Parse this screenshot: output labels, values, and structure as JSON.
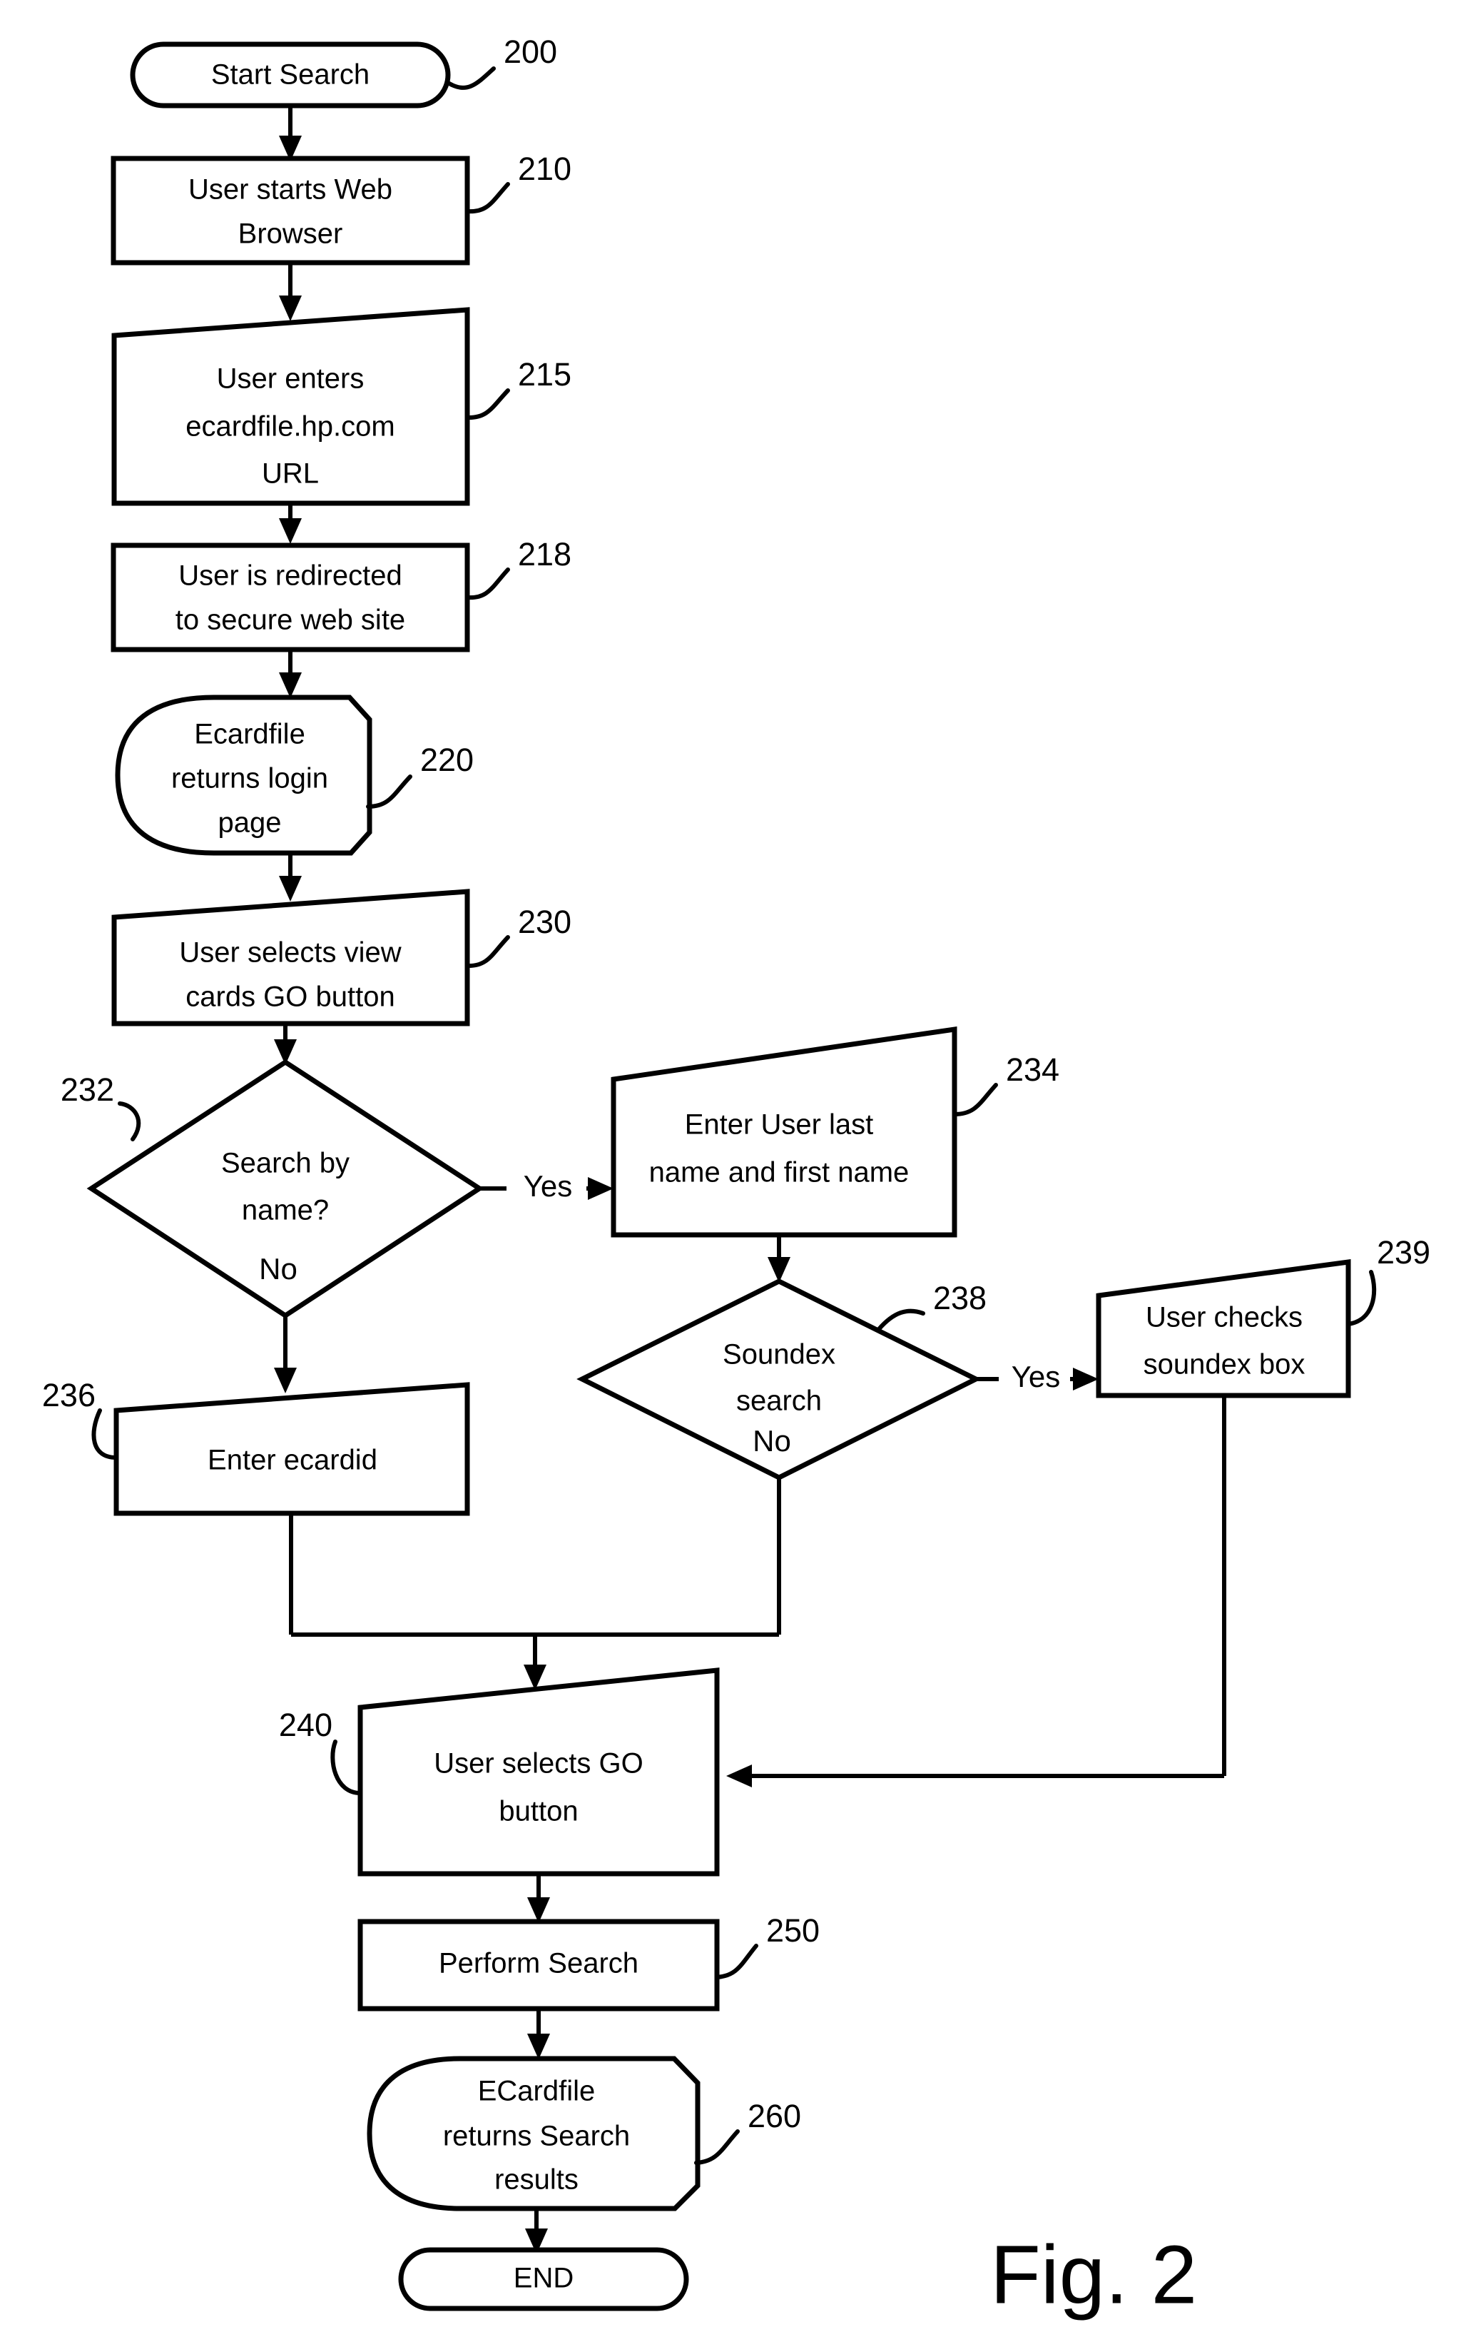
{
  "figure": {
    "caption": "Fig. 2",
    "type": "flowchart"
  },
  "nodes": [
    {
      "ref": "200",
      "shape": "terminator",
      "lines": [
        "Start Search"
      ],
      "text": "Start Search"
    },
    {
      "ref": "210",
      "shape": "rectangle",
      "lines": [
        "User starts Web",
        "Browser"
      ],
      "text": "User starts Web Browser"
    },
    {
      "ref": "215",
      "shape": "slanted-top-quad",
      "lines": [
        "User enters",
        "ecardfile.hp.com",
        "URL"
      ],
      "text": "User enters ecardfile.hp.com URL"
    },
    {
      "ref": "218",
      "shape": "rectangle",
      "lines": [
        "User is redirected",
        "to secure web site"
      ],
      "text": "User is redirected to secure web site"
    },
    {
      "ref": "220",
      "shape": "rounded-blob",
      "lines": [
        "Ecardfile",
        "returns login",
        "page"
      ],
      "text": "Ecardfile returns login page"
    },
    {
      "ref": "230",
      "shape": "slanted-top-quad",
      "lines": [
        "User selects view",
        "cards GO button"
      ],
      "text": "User selects view cards GO button"
    },
    {
      "ref": "232",
      "shape": "diamond",
      "lines": [
        "Search by",
        "name?"
      ],
      "text": "Search by name?"
    },
    {
      "ref": "234",
      "shape": "slanted-top-quad",
      "lines": [
        "Enter User last",
        "name and first name"
      ],
      "text": "Enter User last name and first name"
    },
    {
      "ref": "236",
      "shape": "slanted-top-quad",
      "lines": [
        "Enter ecardid"
      ],
      "text": "Enter ecardid"
    },
    {
      "ref": "238",
      "shape": "diamond",
      "lines": [
        "Soundex",
        "search"
      ],
      "text": "Soundex search"
    },
    {
      "ref": "239",
      "shape": "slanted-top-quad",
      "lines": [
        "User checks",
        "soundex box"
      ],
      "text": "User checks soundex box"
    },
    {
      "ref": "240",
      "shape": "slanted-top-quad",
      "lines": [
        "User selects GO",
        "button"
      ],
      "text": "User selects GO button"
    },
    {
      "ref": "250",
      "shape": "rectangle",
      "lines": [
        "Perform Search"
      ],
      "text": "Perform Search"
    },
    {
      "ref": "260",
      "shape": "rounded-blob",
      "lines": [
        "ECardfile",
        "returns Search",
        "results"
      ],
      "text": "ECardfile returns Search results"
    },
    {
      "ref": "end",
      "shape": "terminator",
      "lines": [
        "END"
      ],
      "text": "END"
    }
  ],
  "edge_labels": {
    "search_by_name_yes": "Yes",
    "search_by_name_no": "No",
    "soundex_yes": "Yes",
    "soundex_no": "No"
  },
  "ref_numbers": {
    "n200": "200",
    "n210": "210",
    "n215": "215",
    "n218": "218",
    "n220": "220",
    "n230": "230",
    "n232": "232",
    "n234": "234",
    "n236": "236",
    "n238": "238",
    "n239": "239",
    "n240": "240",
    "n250": "250",
    "n260": "260"
  },
  "node_text": {
    "start_search": "Start Search",
    "user_starts_web": "User starts Web",
    "browser": "Browser",
    "user_enters": "User enters",
    "ecardfile_url": "ecardfile.hp.com",
    "url": "URL",
    "user_is_redirected": "User is redirected",
    "to_secure_web_site": "to secure web site",
    "ecardfile": "Ecardfile",
    "returns_login": "returns login",
    "page": "page",
    "user_selects_view": "User selects view",
    "cards_go_button": "cards GO button",
    "search_by": "Search by",
    "name_q": "name?",
    "enter_user_last": "Enter User last",
    "name_and_first_name": "name and first name",
    "enter_ecardid": "Enter ecardid",
    "soundex": "Soundex",
    "search": "search",
    "user_checks": "User checks",
    "soundex_box": "soundex box",
    "user_selects_go": "User selects GO",
    "button": "button",
    "perform_search": "Perform Search",
    "ecardfile_caps": "ECardfile",
    "returns_search": "returns Search",
    "results": "results",
    "end": "END"
  },
  "colors": {
    "stroke": "#000000",
    "fill": "#ffffff",
    "background": "#ffffff"
  }
}
